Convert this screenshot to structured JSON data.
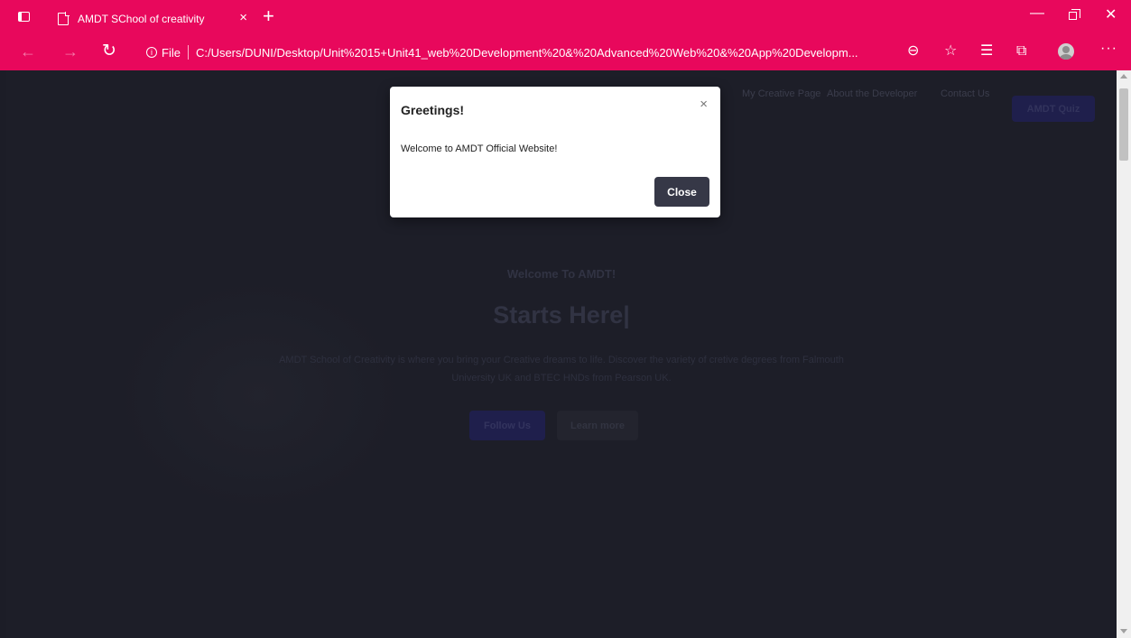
{
  "browser": {
    "tab": {
      "title": "AMDT SChool of creativity",
      "close_glyph": "×"
    },
    "new_tab_glyph": "+",
    "address": {
      "scheme": "File",
      "url": "C:/Users/DUNI/Desktop/Unit%2015+Unit41_web%20Development%20&%20Advanced%20Web%20&%20App%20Developm..."
    },
    "accent_color": "#e8085c"
  },
  "site": {
    "nav": {
      "links": [
        "My Creative Page",
        "About the Developer",
        "Contact Us"
      ],
      "quiz_button": "AMDT Quiz"
    },
    "hero": {
      "subtitle": "Welcome To AMDT!",
      "title": "Starts Here|",
      "text": "AMDT School of Creativity is where you bring your Creative dreams to life. Discover the variety of cretive degrees from Falmouth University UK and BTEC HNDs from Pearson UK.",
      "follow_button": "Follow Us",
      "learn_button": "Learn more"
    }
  },
  "modal": {
    "title": "Greetings!",
    "close_x": "×",
    "body": "Welcome to AMDT Official Website!",
    "close_button": "Close"
  }
}
